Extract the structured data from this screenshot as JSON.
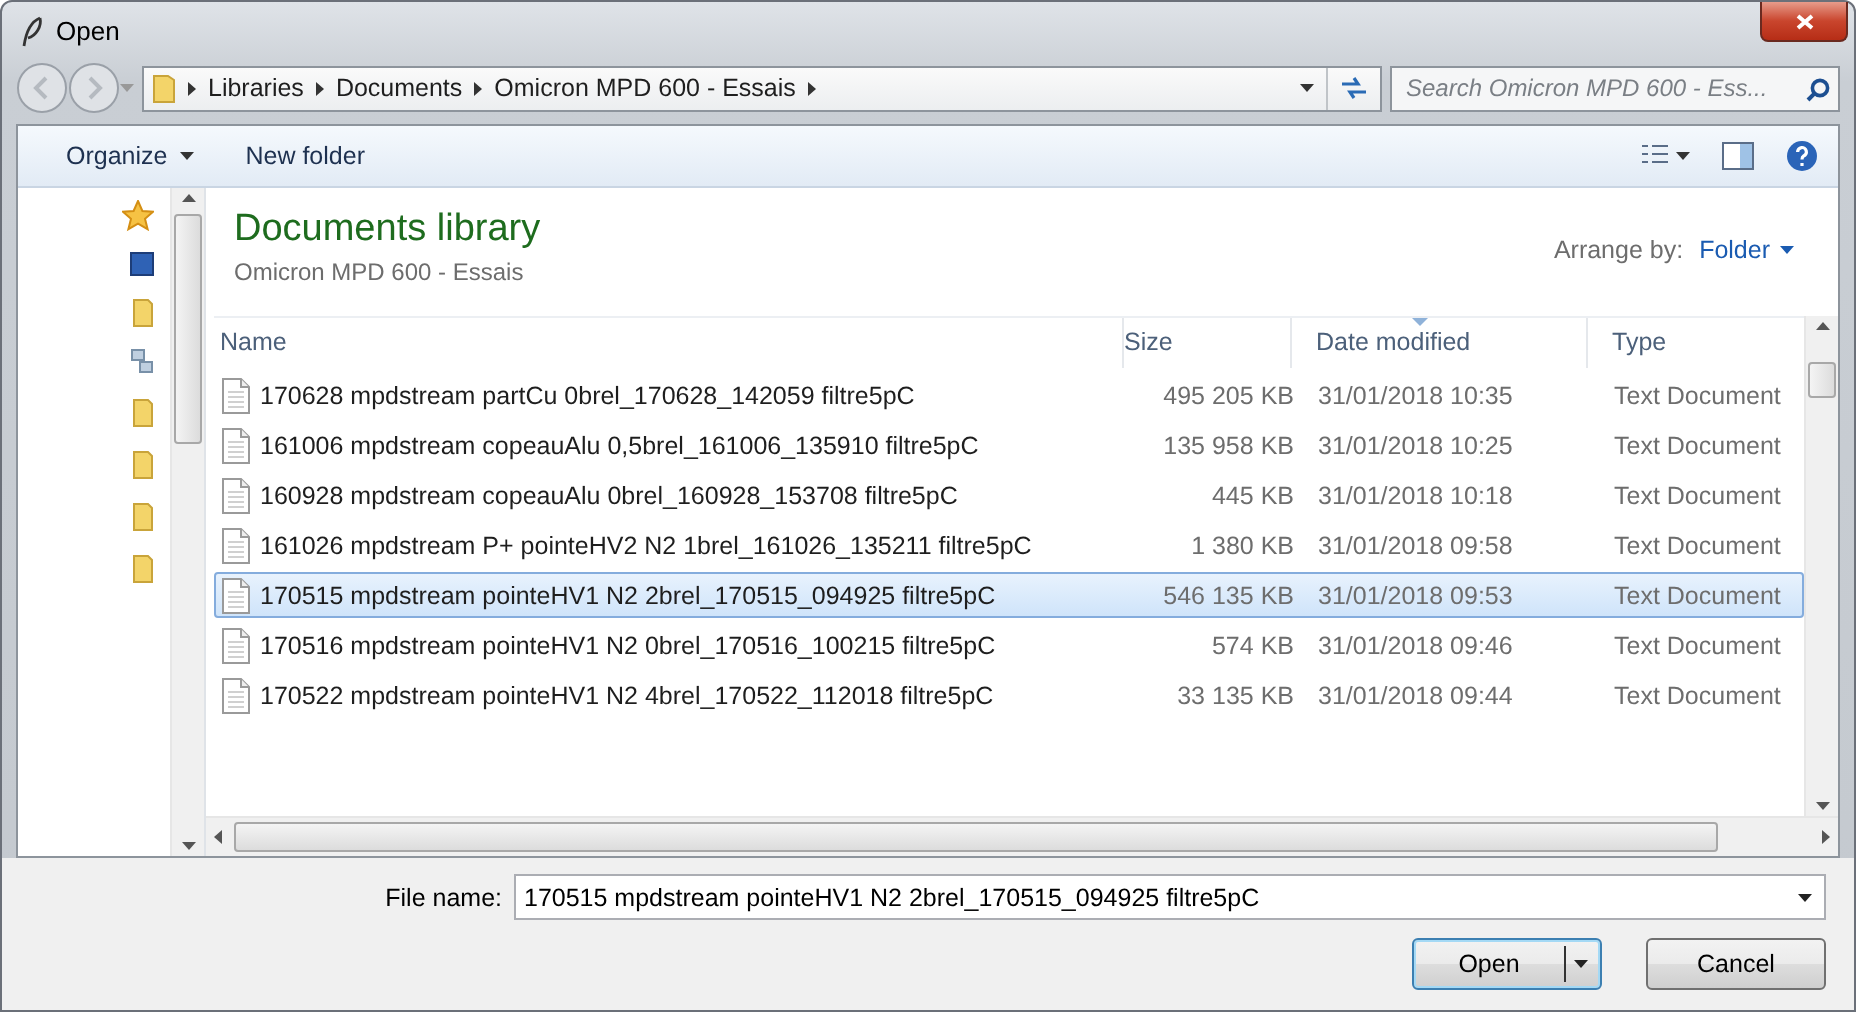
{
  "window": {
    "title": "Open"
  },
  "address_bar": {
    "breadcrumbs": [
      "Libraries",
      "Documents",
      "Omicron MPD 600 - Essais"
    ]
  },
  "search": {
    "placeholder": "Search Omicron MPD 600 - Ess..."
  },
  "toolbar": {
    "buttons": [
      {
        "label": "Organize",
        "has_menu": true
      },
      {
        "label": "New folder",
        "has_menu": false
      }
    ]
  },
  "library": {
    "title": "Documents library",
    "subtitle": "Omicron MPD 600 - Essais",
    "arrange_label": "Arrange by:",
    "arrange_value": "Folder"
  },
  "table": {
    "columns": [
      {
        "label": "Name",
        "sorted": false
      },
      {
        "label": "Size",
        "sorted": false
      },
      {
        "label": "Date modified",
        "sorted": true
      },
      {
        "label": "Type",
        "sorted": false
      }
    ],
    "rows": [
      {
        "name": "170628 mpdstream partCu 0brel_170628_142059 filtre5pC",
        "size": "495 205 KB",
        "date": "31/01/2018 10:35",
        "type": "Text Document",
        "selected": false
      },
      {
        "name": "161006 mpdstream copeauAlu 0,5brel_161006_135910 filtre5pC",
        "size": "135 958 KB",
        "date": "31/01/2018 10:25",
        "type": "Text Document",
        "selected": false
      },
      {
        "name": "160928 mpdstream copeauAlu 0brel_160928_153708 filtre5pC",
        "size": "445 KB",
        "date": "31/01/2018 10:18",
        "type": "Text Document",
        "selected": false
      },
      {
        "name": "161026 mpdstream P+ pointeHV2 N2 1brel_161026_135211 filtre5pC",
        "size": "1 380 KB",
        "date": "31/01/2018 09:58",
        "type": "Text Document",
        "selected": false
      },
      {
        "name": "170515 mpdstream pointeHV1 N2 2brel_170515_094925 filtre5pC",
        "size": "546 135 KB",
        "date": "31/01/2018 09:53",
        "type": "Text Document",
        "selected": true
      },
      {
        "name": "170516 mpdstream pointeHV1 N2 0brel_170516_100215 filtre5pC",
        "size": "574 KB",
        "date": "31/01/2018 09:46",
        "type": "Text Document",
        "selected": false
      },
      {
        "name": "170522 mpdstream pointeHV1 N2 4brel_170522_112018 filtre5pC",
        "size": "33 135 KB",
        "date": "31/01/2018 09:44",
        "type": "Text Document",
        "selected": false
      }
    ]
  },
  "file_name": {
    "label": "File name:",
    "value": "170515 mpdstream pointeHV1 N2 2brel_170515_094925 filtre5pC"
  },
  "buttons": [
    {
      "label": "Open",
      "kind": "split"
    },
    {
      "label": "Cancel",
      "kind": "plain"
    }
  ]
}
